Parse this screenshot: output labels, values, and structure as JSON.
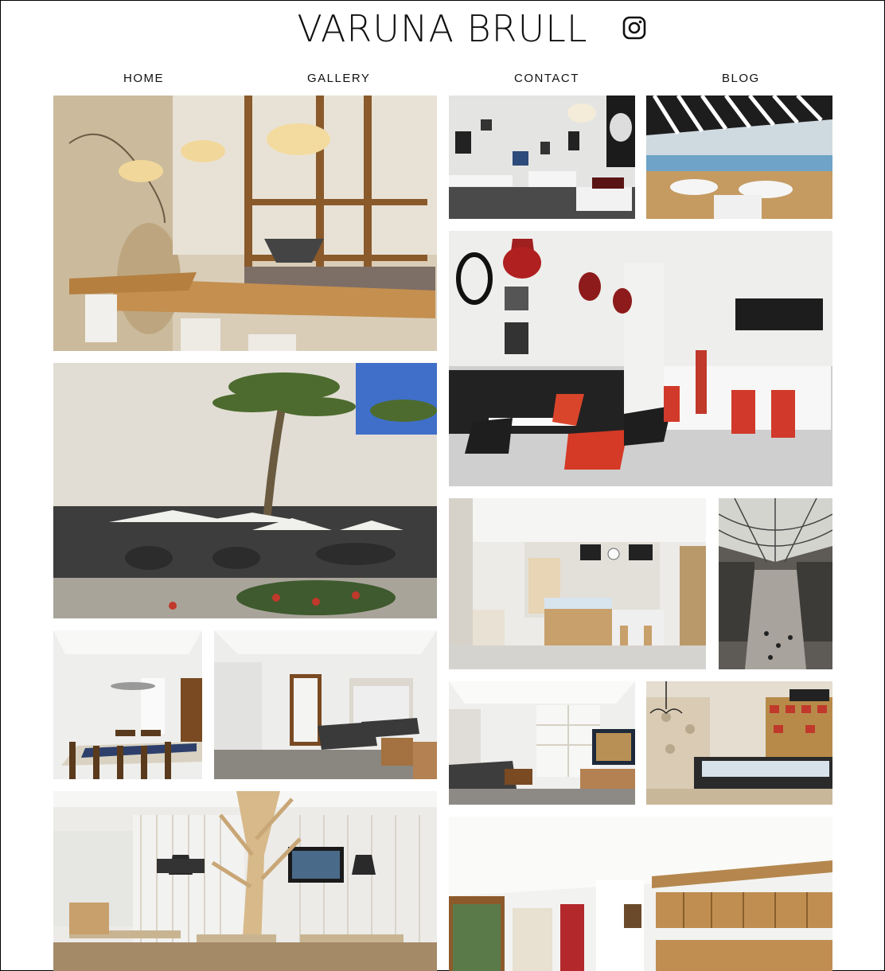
{
  "header": {
    "title": "VARUNA BRULL",
    "social_icon": "instagram-icon"
  },
  "nav": {
    "items": [
      {
        "label": "HOME"
      },
      {
        "label": "GALLERY"
      },
      {
        "label": "CONTACT"
      },
      {
        "label": "BLOG"
      }
    ]
  },
  "gallery": {
    "photos": [
      {
        "id": "restaurant-mural-interior"
      },
      {
        "id": "dining-room-framed-photos"
      },
      {
        "id": "seaside-terrace-awning"
      },
      {
        "id": "cafeteria-red-pendants"
      },
      {
        "id": "palm-plaza-terrace"
      },
      {
        "id": "bakery-counter"
      },
      {
        "id": "iron-glass-arcade"
      },
      {
        "id": "dining-room-blue-runner"
      },
      {
        "id": "living-room-sofas"
      },
      {
        "id": "living-room-shelves"
      },
      {
        "id": "deli-shop-chandelier"
      },
      {
        "id": "restaurant-wooden-tree"
      },
      {
        "id": "rustic-kitchen-cabinets"
      }
    ]
  },
  "colors": {
    "text": "#111111",
    "accent_red": "#c0392b",
    "wood": "#c89a5b"
  }
}
